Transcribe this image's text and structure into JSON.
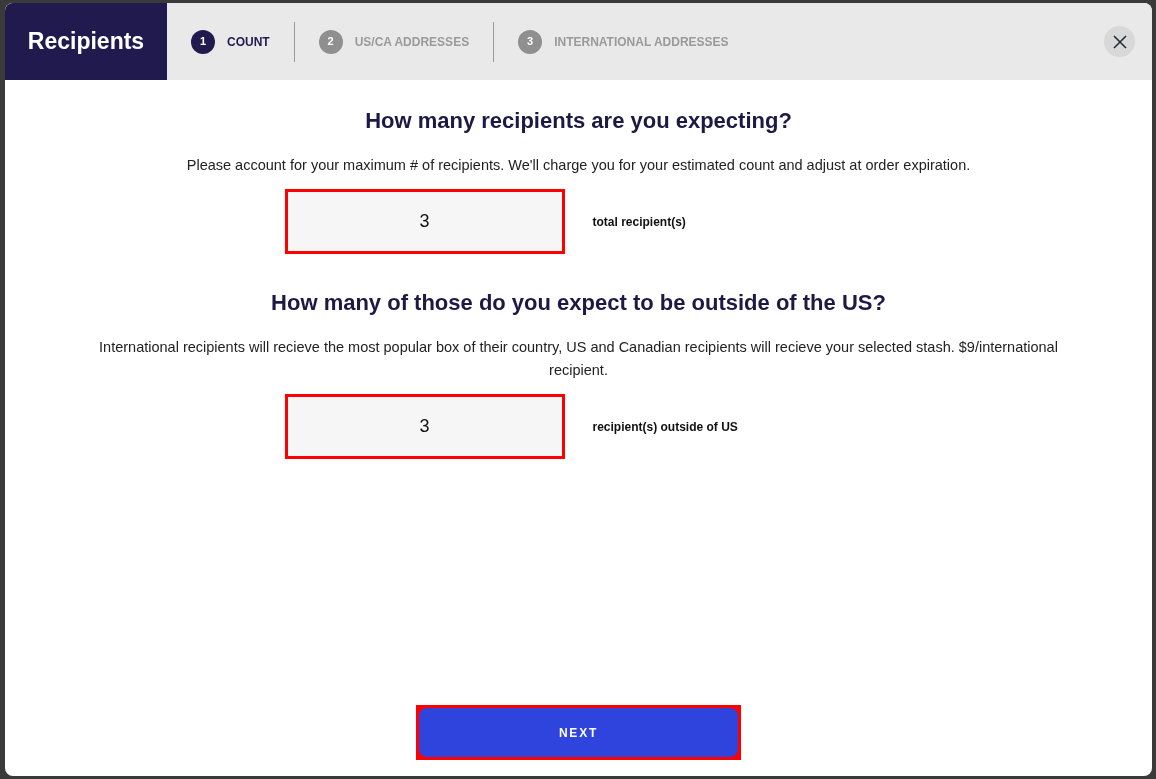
{
  "modal": {
    "title": "Recipients"
  },
  "steps": [
    {
      "number": "1",
      "label": "COUNT",
      "selected": true
    },
    {
      "number": "2",
      "label": "US/CA ADDRESSES",
      "selected": false
    },
    {
      "number": "3",
      "label": "INTERNATIONAL ADDRESSES",
      "selected": false
    }
  ],
  "questions": [
    {
      "heading": "How many recipients are you expecting?",
      "description": "Please account for your maximum # of recipients. We'll charge you for your estimated count and adjust at order expiration.",
      "value": "3",
      "unit_label": "total recipient(s)",
      "highlighted": true
    },
    {
      "heading": "How many of those do you expect to be outside of the US?",
      "description": "International recipients will recieve the most popular box of their country, US and Canadian recipients will recieve your selected stash. $9/international recipient.",
      "value": "3",
      "unit_label": "recipient(s) outside of US",
      "highlighted": true
    }
  ],
  "next_button": {
    "label": "NEXT",
    "highlighted": true
  }
}
